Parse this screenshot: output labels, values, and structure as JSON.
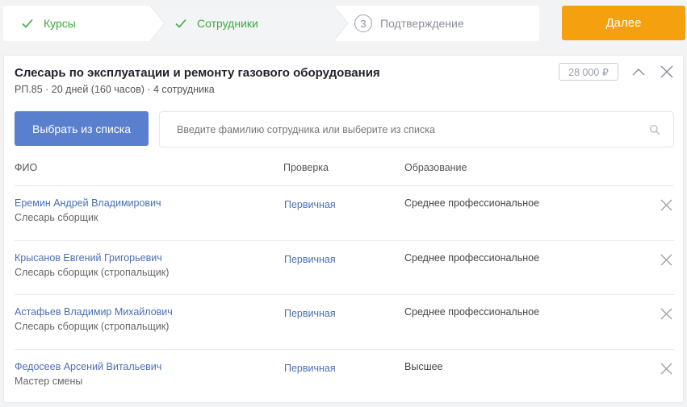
{
  "steps": [
    {
      "label": "Курсы",
      "state": "done"
    },
    {
      "label": "Сотрудники",
      "state": "done"
    },
    {
      "label": "Подтверждение",
      "state": "pending",
      "number": "3"
    }
  ],
  "next_button": "Далее",
  "course": {
    "title": "Слесарь по эксплуатации и ремонту газового оборудования",
    "meta": "РП.85 · 20 дней (160 часов) · 4 сотрудника",
    "price": "28 000 ₽"
  },
  "select_button": "Выбрать из списка",
  "search": {
    "placeholder": "Введите фамилию сотрудника или выберите из списка",
    "value": ""
  },
  "table": {
    "headers": [
      "ФИО",
      "Проверка",
      "Образование"
    ],
    "rows": [
      {
        "name": "Еремин Андрей Владимирович",
        "position": "Слесарь сборщик",
        "check": "Первичная",
        "education": "Среднее профессиональное"
      },
      {
        "name": "Крысанов Евгений Григорьевич",
        "position": "Слесарь сборщик (стропальщик)",
        "check": "Первичная",
        "education": "Среднее профессиональное"
      },
      {
        "name": "Астафьев Владимир Михайлович",
        "position": "Слесарь сборщик (стропальщик)",
        "check": "Первичная",
        "education": "Среднее профессиональное"
      },
      {
        "name": "Федосеев Арсений Витальевич",
        "position": "Мастер смены",
        "check": "Первичная",
        "education": "Высшее"
      }
    ]
  },
  "colors": {
    "accent_orange": "#f5a00e",
    "primary_blue": "#5b7fcf",
    "link_blue": "#4a6fb5",
    "done_green": "#3cab3c"
  },
  "icons": {
    "done": "check-icon",
    "collapse": "chevron-up-icon",
    "close": "close-icon",
    "search": "search-icon",
    "remove": "close-icon"
  }
}
